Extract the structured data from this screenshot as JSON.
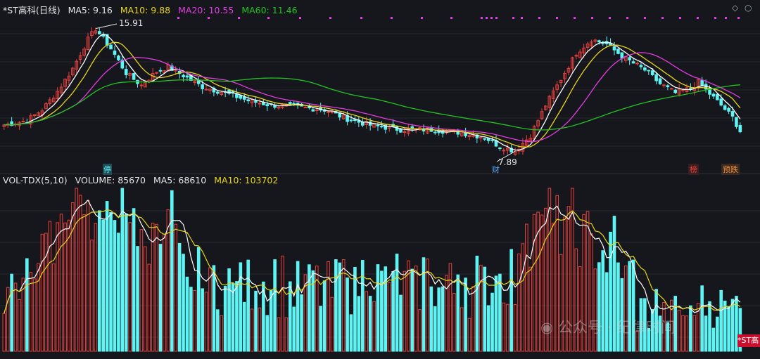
{
  "price_header": {
    "title": "*ST高科(日线)",
    "ma5_label": "MA5: 9.16",
    "ma10_label": "MA10: 9.88",
    "ma20_label": "MA20: 10.55",
    "ma60_label": "MA60: 11.46"
  },
  "volume_header": {
    "title": "VOL-TDX(5,10)",
    "volume_label": "VOLUME: 85670",
    "ma5_label": "MA5: 68610",
    "ma10_label": "MA10: 103702"
  },
  "annotations": {
    "high": "15.91",
    "low": "7.89",
    "tag_limit": "停",
    "tag_finance": "财",
    "tag_list": "榜",
    "tag_forecast": "预跌",
    "watermark": "公众号 · 纪律时间",
    "corner_tag": "*ST高"
  },
  "colors": {
    "up": "#e8413d",
    "down": "#5ff4f4",
    "ma5": "#ffffff",
    "ma10": "#e6d41a",
    "ma20": "#e23ce0",
    "ma60": "#23c223",
    "bg": "#16171c"
  },
  "chart_data": [
    {
      "type": "candlestick",
      "title": "*ST高科(日线)",
      "series": [
        {
          "name": "MA5",
          "last": 9.16
        },
        {
          "name": "MA10",
          "last": 9.88
        },
        {
          "name": "MA20",
          "last": 10.55
        },
        {
          "name": "MA60",
          "last": 11.46
        }
      ],
      "approx_close_path": [
        [
          0,
          9.6
        ],
        [
          6,
          9.9
        ],
        [
          10,
          10.6
        ],
        [
          14,
          11.8
        ],
        [
          18,
          13.3
        ],
        [
          22,
          15.2
        ],
        [
          24,
          15.9
        ],
        [
          28,
          14.6
        ],
        [
          32,
          13.0
        ],
        [
          36,
          12.2
        ],
        [
          40,
          13.1
        ],
        [
          43,
          13.4
        ],
        [
          48,
          12.7
        ],
        [
          52,
          12.1
        ],
        [
          58,
          11.7
        ],
        [
          64,
          11.2
        ],
        [
          70,
          10.9
        ],
        [
          76,
          10.8
        ],
        [
          84,
          10.6
        ],
        [
          90,
          10.0
        ],
        [
          96,
          9.6
        ],
        [
          104,
          9.3
        ],
        [
          112,
          9.3
        ],
        [
          120,
          9.1
        ],
        [
          126,
          8.8
        ],
        [
          130,
          8.2
        ],
        [
          134,
          7.9
        ],
        [
          138,
          8.9
        ],
        [
          142,
          10.9
        ],
        [
          146,
          12.6
        ],
        [
          150,
          14.3
        ],
        [
          154,
          15.2
        ],
        [
          158,
          14.9
        ],
        [
          162,
          14.1
        ],
        [
          168,
          13.2
        ],
        [
          172,
          12.3
        ],
        [
          176,
          11.7
        ],
        [
          180,
          12.0
        ],
        [
          182,
          12.4
        ],
        [
          186,
          11.4
        ],
        [
          188,
          10.9
        ],
        [
          191,
          10.1
        ],
        [
          193,
          9.2
        ]
      ],
      "price_marks": {
        "high": 15.91,
        "low": 7.89
      }
    },
    {
      "type": "bar",
      "title": "VOL-TDX(5,10)",
      "series": [
        {
          "name": "VOLUME",
          "last": 85670
        },
        {
          "name": "MA5",
          "last": 68610
        },
        {
          "name": "MA10",
          "last": 103702
        }
      ]
    }
  ]
}
